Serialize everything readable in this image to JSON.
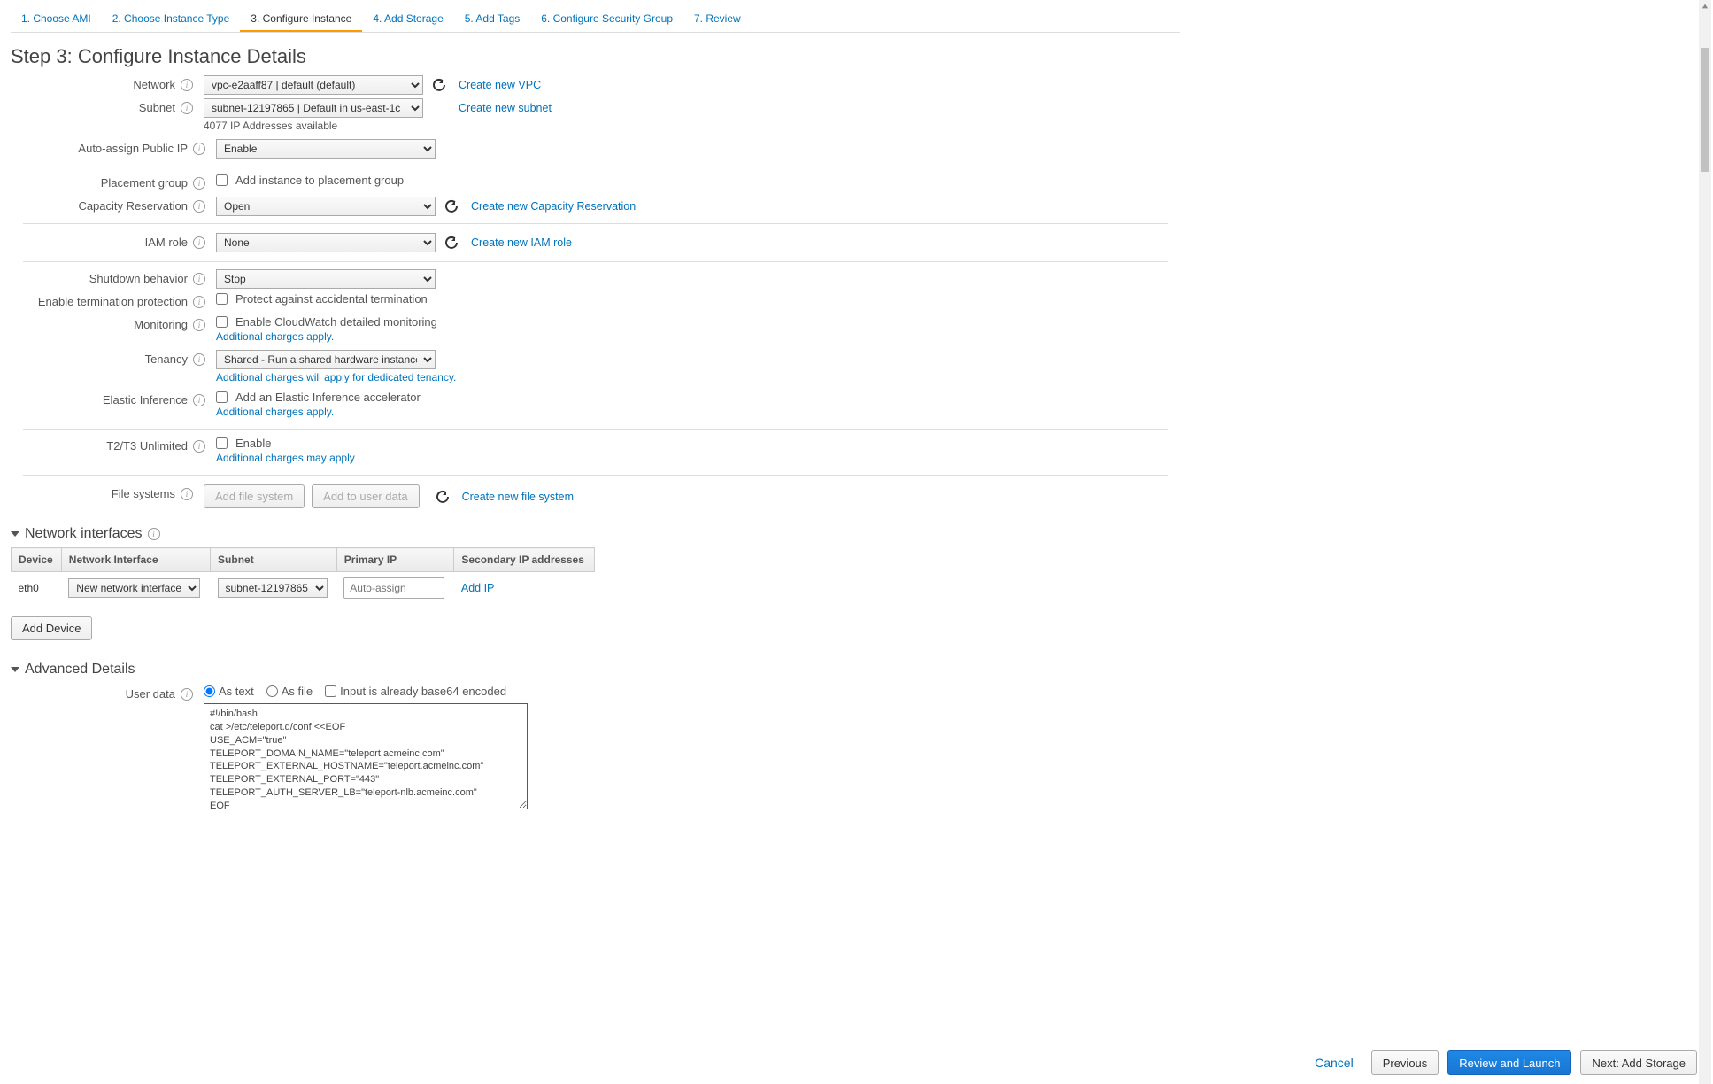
{
  "tabs": [
    "1. Choose AMI",
    "2. Choose Instance Type",
    "3. Configure Instance",
    "4. Add Storage",
    "5. Add Tags",
    "6. Configure Security Group",
    "7. Review"
  ],
  "active_tab_index": 2,
  "page_title": "Step 3: Configure Instance Details",
  "fields": {
    "network": {
      "label": "Network",
      "value": "vpc-e2aaff87 | default (default)",
      "link": "Create new VPC"
    },
    "subnet": {
      "label": "Subnet",
      "value": "subnet-12197865 | Default in us-east-1c",
      "link": "Create new subnet",
      "note": "4077 IP Addresses available"
    },
    "auto_public_ip": {
      "label": "Auto-assign Public IP",
      "value": "Enable"
    },
    "placement_group": {
      "label": "Placement group",
      "checkbox_label": "Add instance to placement group"
    },
    "capacity_reservation": {
      "label": "Capacity Reservation",
      "value": "Open",
      "link": "Create new Capacity Reservation"
    },
    "iam_role": {
      "label": "IAM role",
      "value": "None",
      "link": "Create new IAM role"
    },
    "shutdown_behavior": {
      "label": "Shutdown behavior",
      "value": "Stop"
    },
    "termination_protection": {
      "label": "Enable termination protection",
      "checkbox_label": "Protect against accidental termination"
    },
    "monitoring": {
      "label": "Monitoring",
      "checkbox_label": "Enable CloudWatch detailed monitoring",
      "note": "Additional charges apply."
    },
    "tenancy": {
      "label": "Tenancy",
      "value": "Shared - Run a shared hardware instance",
      "note": "Additional charges will apply for dedicated tenancy."
    },
    "elastic_inference": {
      "label": "Elastic Inference",
      "checkbox_label": "Add an Elastic Inference accelerator",
      "note": "Additional charges apply."
    },
    "t2t3": {
      "label": "T2/T3 Unlimited",
      "checkbox_label": "Enable",
      "note": "Additional charges may apply"
    },
    "file_systems": {
      "label": "File systems",
      "btn1": "Add file system",
      "btn2": "Add to user data",
      "link": "Create new file system"
    }
  },
  "network_interfaces": {
    "title": "Network interfaces",
    "headers": [
      "Device",
      "Network Interface",
      "Subnet",
      "Primary IP",
      "Secondary IP addresses"
    ],
    "row": {
      "device": "eth0",
      "ni": "New network interface",
      "subnet": "subnet-12197865",
      "primary_ip_placeholder": "Auto-assign",
      "add_ip": "Add IP"
    },
    "add_device": "Add Device"
  },
  "advanced": {
    "title": "Advanced Details",
    "user_data_label": "User data",
    "radio_text": "As text",
    "radio_file": "As file",
    "checkbox_base64": "Input is already base64 encoded",
    "textarea": "#!/bin/bash\ncat >/etc/teleport.d/conf <<EOF\nUSE_ACM=\"true\"\nTELEPORT_DOMAIN_NAME=\"teleport.acmeinc.com\"\nTELEPORT_EXTERNAL_HOSTNAME=\"teleport.acmeinc.com\"\nTELEPORT_EXTERNAL_PORT=\"443\"\nTELEPORT_AUTH_SERVER_LB=\"teleport-nlb.acmeinc.com\"\nEOF"
  },
  "footer": {
    "cancel": "Cancel",
    "previous": "Previous",
    "review": "Review and Launch",
    "next": "Next: Add Storage"
  }
}
